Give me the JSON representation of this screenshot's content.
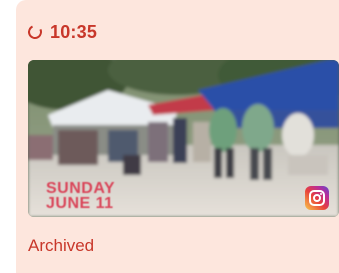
{
  "card": {
    "time": "10:35",
    "thumbnail": {
      "overlay_line1": "SUNDAY",
      "overlay_line2": "JUNE 11",
      "badge_icon": "instagram-icon"
    },
    "status": "Archived"
  },
  "colors": {
    "card_background": "#fde6dd",
    "accent": "#c8372a"
  }
}
